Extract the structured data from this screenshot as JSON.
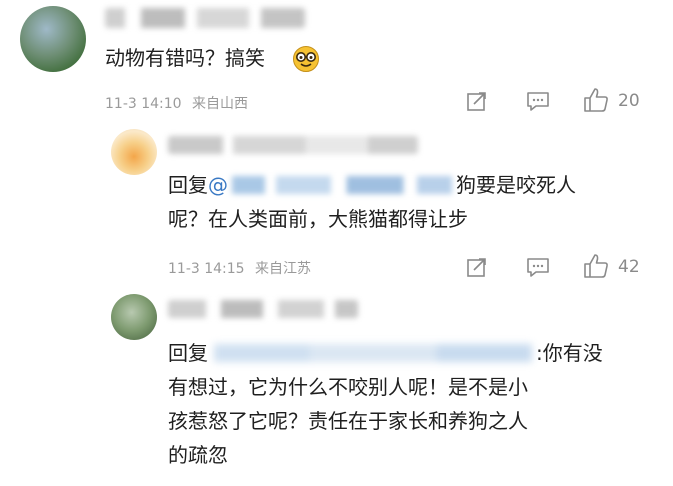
{
  "comment1": {
    "text": "动物有错吗？搞笑",
    "time": "11-3 14:10",
    "location": "来自山西",
    "likes": "20"
  },
  "reply1": {
    "prefix": "回复",
    "mention": "@",
    "line1_tail": "狗要是咬死人",
    "line2": "呢？在人类面前，大熊猫都得让步",
    "time": "11-3 14:15",
    "location": "来自江苏",
    "likes": "42"
  },
  "reply2": {
    "prefix": "回复",
    "line1_tail": ":你有没",
    "line2": "有想过，它为什么不咬别人呢！是不是小",
    "line3": "孩惹怒了它呢？责任在于家长和养狗之人",
    "line4": "的疏忽"
  },
  "icons": {
    "emoji": "smiling-face-with-glasses-icon",
    "share": "share-icon",
    "comment": "comment-icon",
    "like": "thumbs-up-icon"
  },
  "colors": {
    "mention": "#3a79c4",
    "meta": "#9a9a9a",
    "text": "#1f1f1f"
  }
}
